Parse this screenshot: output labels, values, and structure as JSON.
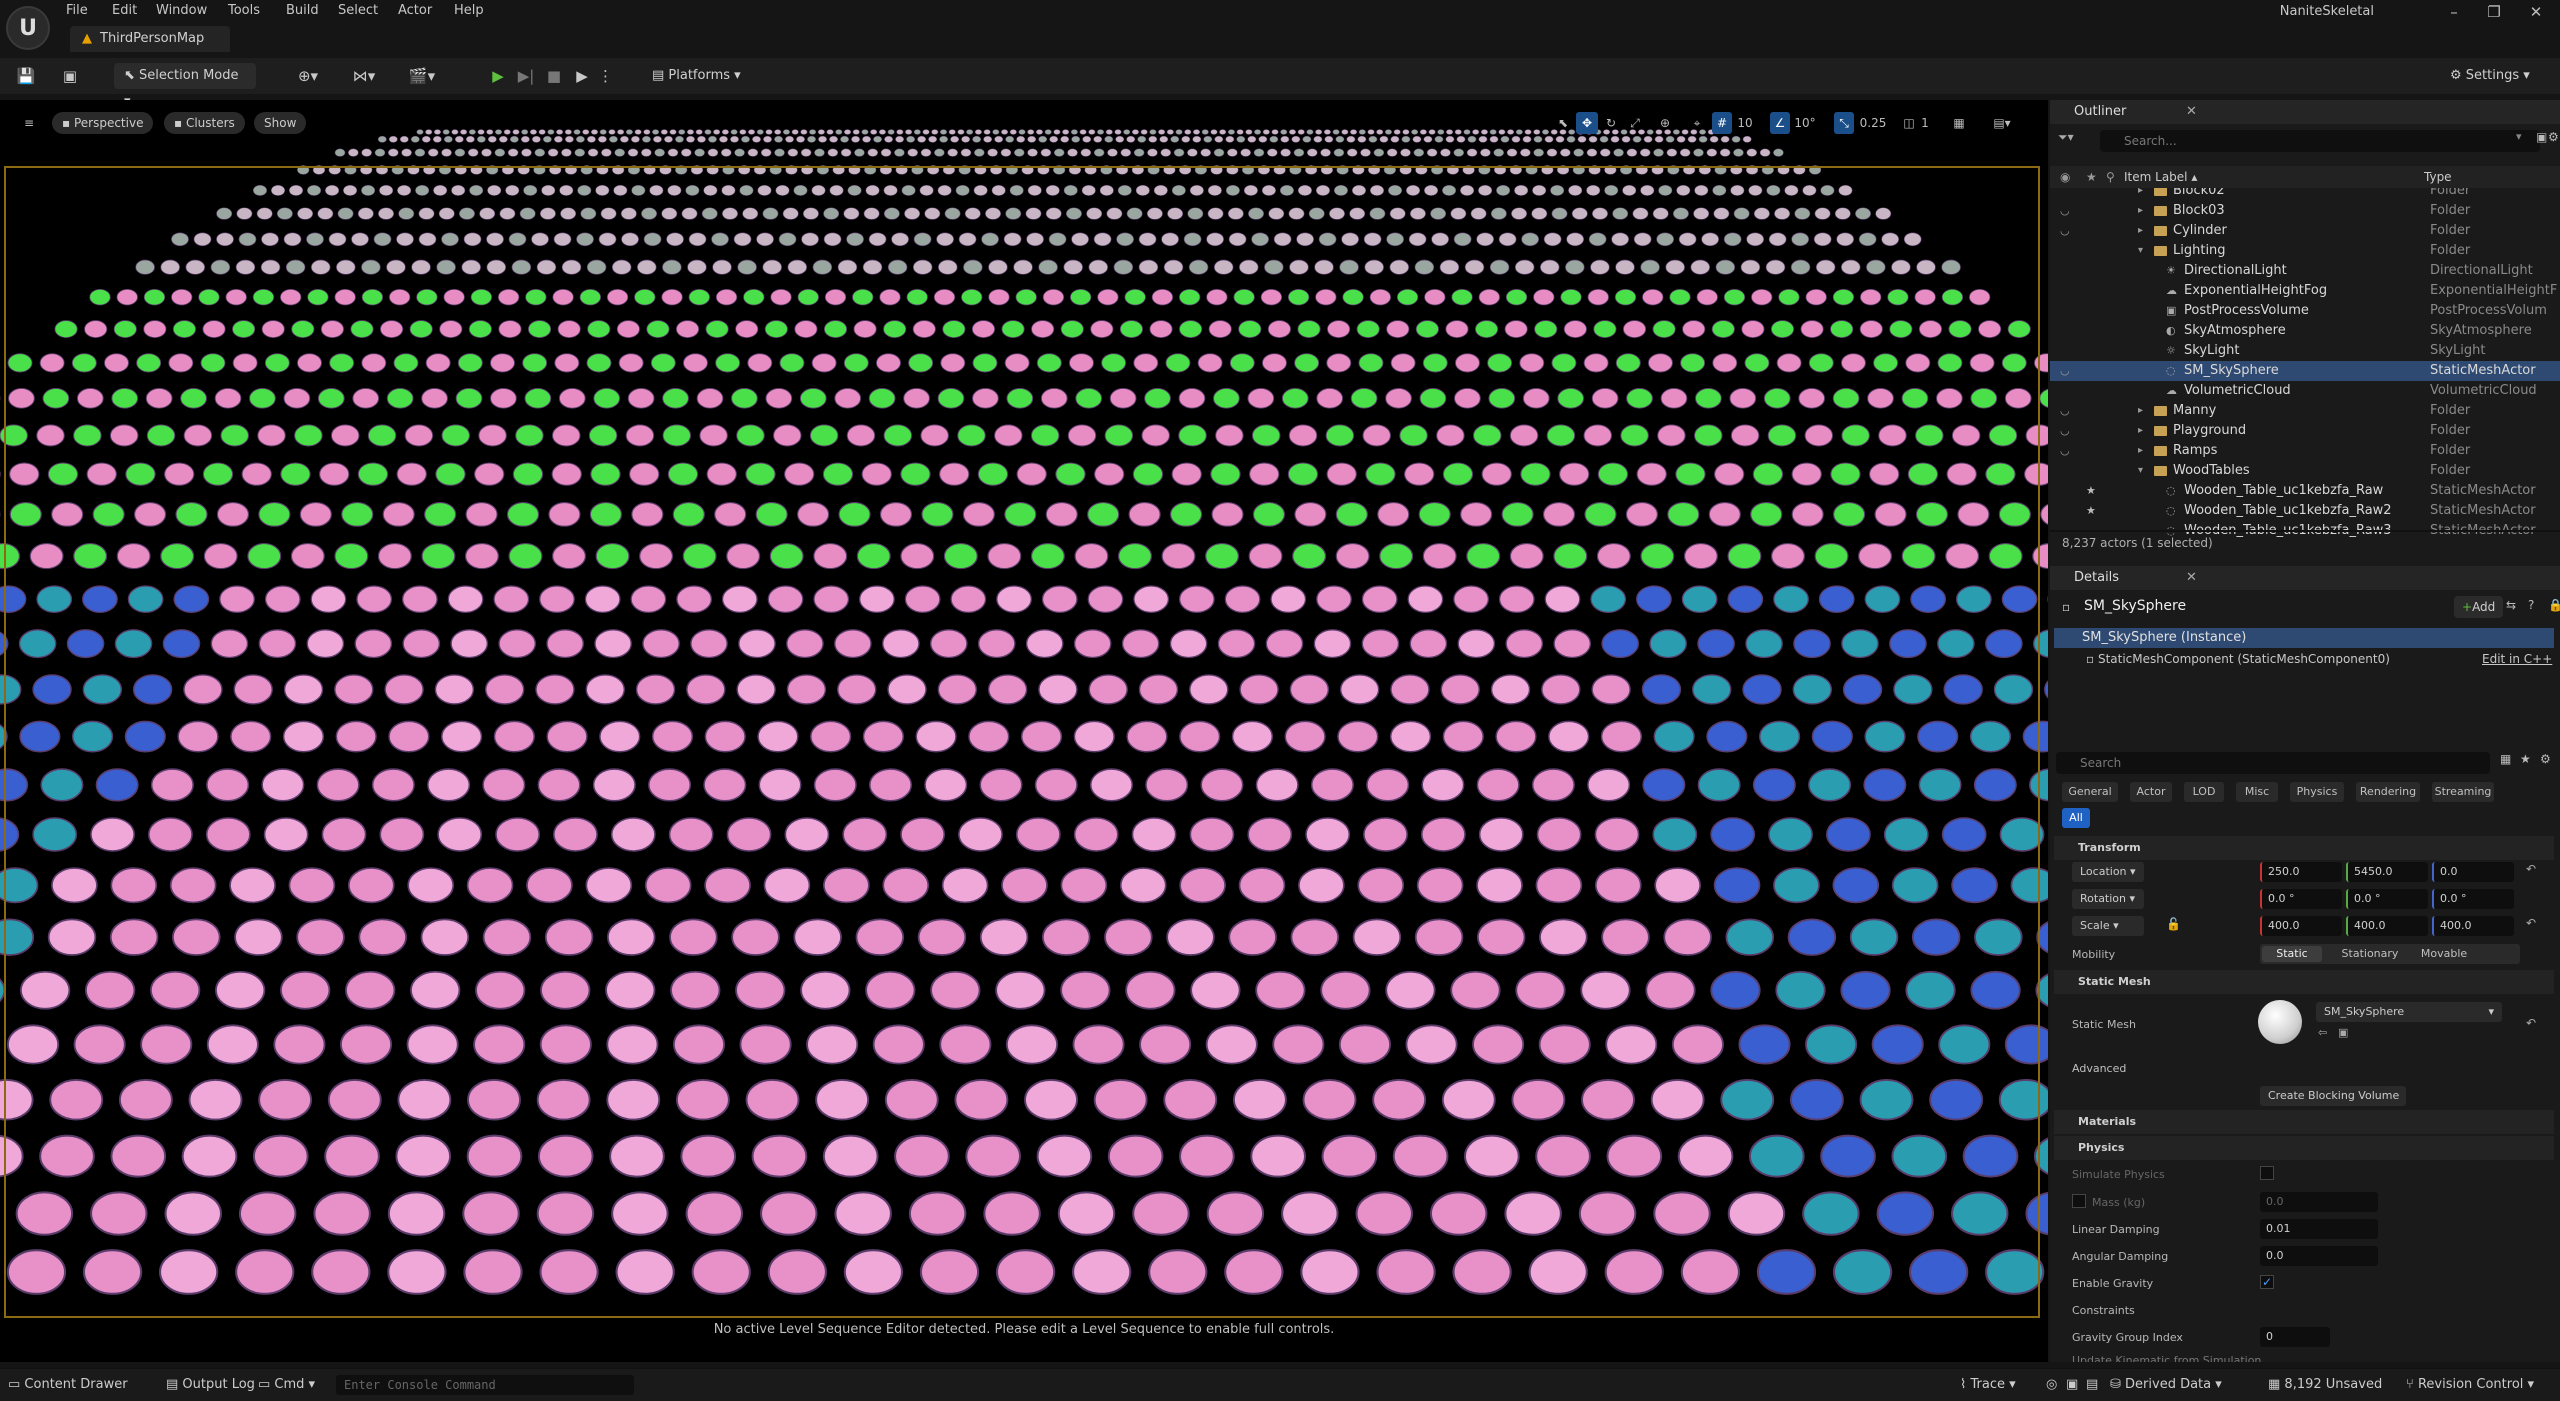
{
  "menu": [
    "File",
    "Edit",
    "Window",
    "Tools",
    "Build",
    "Select",
    "Actor",
    "Help"
  ],
  "map_tab": "ThirdPersonMap",
  "project_name": "NaniteSkeletal",
  "window_buttons": [
    "–",
    "❐",
    "✕"
  ],
  "toolbar": {
    "selection_mode": "Selection Mode",
    "platforms": "Platforms",
    "settings": "Settings"
  },
  "viewport": {
    "perspective": "Perspective",
    "clusters": "Clusters",
    "show": "Show",
    "grid_snap": "10",
    "rotation_snap": "10°",
    "scale_snap": "0.25",
    "camera_speed": "1",
    "sequence_message": "No active Level Sequence Editor detected. Please edit a Level Sequence to enable full controls."
  },
  "outliner": {
    "tab": "Outliner",
    "search_placeholder": "Search...",
    "col_label": "Item Label ▴",
    "col_type": "Type",
    "rows": [
      {
        "label": "Block02",
        "type": "Folder"
      },
      {
        "label": "Block03",
        "type": "Folder"
      },
      {
        "label": "Cylinder",
        "type": "Folder"
      },
      {
        "label": "Lighting",
        "type": "Folder"
      },
      {
        "label": "DirectionalLight",
        "type": "DirectionalLight"
      },
      {
        "label": "ExponentialHeightFog",
        "type": "ExponentialHeightF"
      },
      {
        "label": "PostProcessVolume",
        "type": "PostProcessVolum"
      },
      {
        "label": "SkyAtmosphere",
        "type": "SkyAtmosphere"
      },
      {
        "label": "SkyLight",
        "type": "SkyLight"
      },
      {
        "label": "SM_SkySphere",
        "type": "StaticMeshActor"
      },
      {
        "label": "VolumetricCloud",
        "type": "VolumetricCloud"
      },
      {
        "label": "Manny",
        "type": "Folder"
      },
      {
        "label": "Playground",
        "type": "Folder"
      },
      {
        "label": "Ramps",
        "type": "Folder"
      },
      {
        "label": "WoodTables",
        "type": "Folder"
      },
      {
        "label": "Wooden_Table_uc1kebzfa_Raw",
        "type": "StaticMeshActor"
      },
      {
        "label": "Wooden_Table_uc1kebzfa_Raw2",
        "type": "StaticMeshActor"
      },
      {
        "label": "Wooden_Table_uc1kebzfa_Raw3",
        "type": "StaticMeshActor"
      }
    ],
    "actor_count": "8,237 actors (1 selected)"
  },
  "details": {
    "tab": "Details",
    "actor_name": "SM_SkySphere",
    "add": "Add",
    "instance": "SM_SkySphere (Instance)",
    "component": "StaticMeshComponent (StaticMeshComponent0)",
    "edit_cpp": "Edit in C++",
    "search_placeholder": "Search",
    "categories": [
      "General",
      "Actor",
      "LOD",
      "Misc",
      "Physics",
      "Rendering",
      "Streaming"
    ],
    "all": "All",
    "transform": "Transform",
    "location_label": "Location",
    "location": [
      "250.0",
      "5450.0",
      "0.0"
    ],
    "rotation_label": "Rotation",
    "rotation": [
      "0.0 °",
      "0.0 °",
      "0.0 °"
    ],
    "scale_label": "Scale",
    "scale": [
      "400.0",
      "400.0",
      "400.0"
    ],
    "mobility_label": "Mobility",
    "mobility": [
      "Static",
      "Stationary",
      "Movable"
    ],
    "static_mesh_section": "Static Mesh",
    "static_mesh_label": "Static Mesh",
    "static_mesh_value": "SM_SkySphere",
    "advanced": "Advanced",
    "create_blocking": "Create Blocking Volume",
    "materials": "Materials",
    "physics": "Physics",
    "simulate_physics": "Simulate Physics",
    "mass": "Mass (kg)",
    "mass_value": "0.0",
    "linear_damping": "Linear Damping",
    "linear_damping_value": "0.01",
    "angular_damping": "Angular Damping",
    "angular_damping_value": "0.0",
    "enable_gravity": "Enable Gravity",
    "constraints": "Constraints",
    "gravity_group": "Gravity Group Index",
    "gravity_group_value": "0",
    "truncated_row": "Update Kinematic from Simulation"
  },
  "status": {
    "content_drawer": "Content Drawer",
    "output_log": "Output Log",
    "cmd": "Cmd",
    "console_placeholder": "Enter Console Command",
    "trace": "Trace",
    "derived_data": "Derived Data",
    "unsaved": "8,192 Unsaved",
    "revision_control": "Revision Control"
  }
}
